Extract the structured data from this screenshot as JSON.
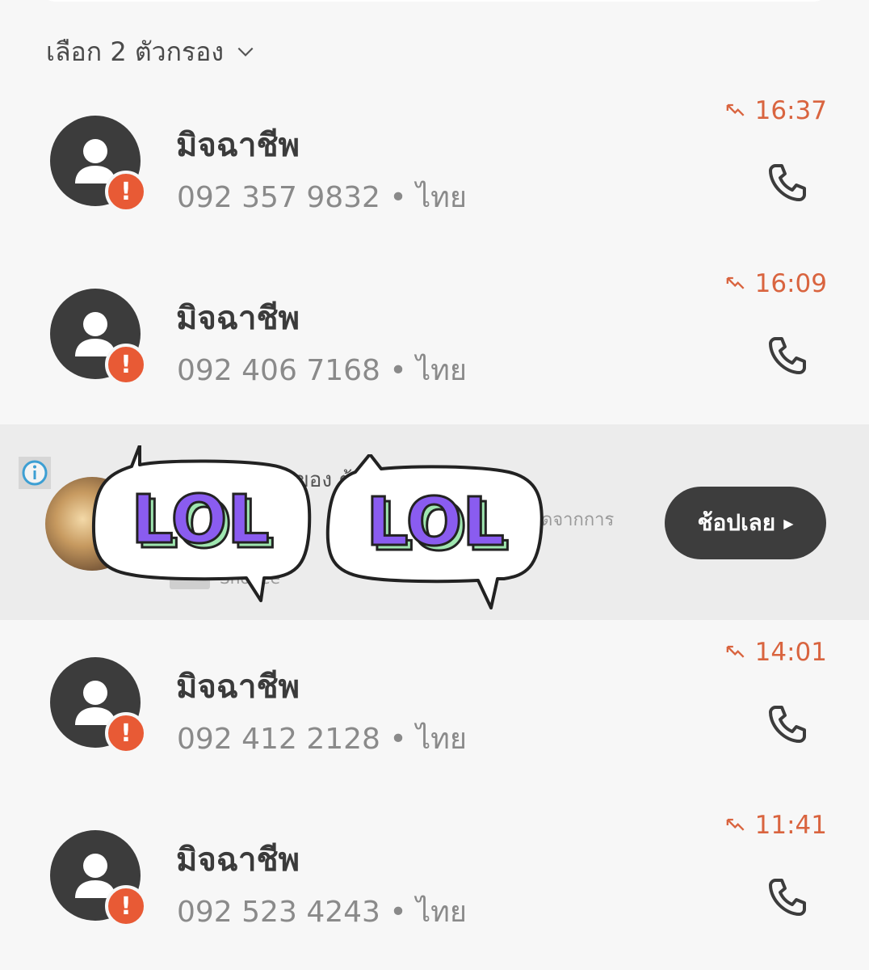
{
  "filter": {
    "label": "เลือก 2 ตัวกรอง"
  },
  "calls": [
    {
      "name": "มิจฉาชีพ",
      "number": "092 357 9832",
      "region": "ไทย",
      "time": "16:37"
    },
    {
      "name": "มิจฉาชีพ",
      "number": "092 406 7168",
      "region": "ไทย",
      "time": "16:09"
    },
    {
      "name": "มิจฉาชีพ",
      "number": "092 412 2128",
      "region": "ไทย",
      "time": "14:01"
    },
    {
      "name": "มิจฉาชีพ",
      "number": "092 523 4243",
      "region": "ไทย",
      "time": "11:41"
    }
  ],
  "ad": {
    "title_fragment": "ของ ต้",
    "desc_fragment": "ดจากการ",
    "source_fragment": "Shopee",
    "cta": "ช้อปเลย"
  },
  "stickers": [
    {
      "text": "LOL"
    },
    {
      "text": "LOL"
    }
  ],
  "colors": {
    "missed": "#d9643f",
    "warning": "#e85a35",
    "avatar": "#3c3c3c",
    "sticker_fill": "#8a5cf0",
    "sticker_shadow": "#9fe6b0"
  }
}
